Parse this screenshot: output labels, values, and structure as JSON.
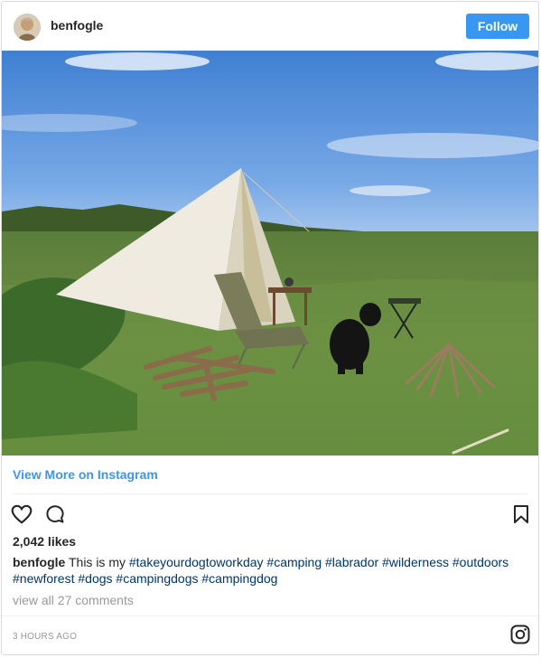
{
  "header": {
    "username": "benfogle",
    "follow_label": "Follow"
  },
  "post": {
    "view_more_label": "View More on Instagram",
    "likes": "2,042 likes",
    "caption_user": "benfogle",
    "caption_text": " This is my ",
    "hashtags": [
      "#takeyourdogtoworkday",
      "#camping",
      "#labrador",
      "#wilderness",
      "#outdoors",
      "#newforest",
      "#dogs",
      "#campingdogs",
      "#campingdog"
    ],
    "comments_label": "view all 27 comments",
    "time": "3 hours ago"
  },
  "colors": {
    "accent": "#3897f0",
    "hashtag": "#003569",
    "muted": "#999999"
  },
  "icons": {
    "like": "heart-icon",
    "comment": "comment-icon",
    "save": "bookmark-icon",
    "brand": "instagram-logo-icon"
  }
}
